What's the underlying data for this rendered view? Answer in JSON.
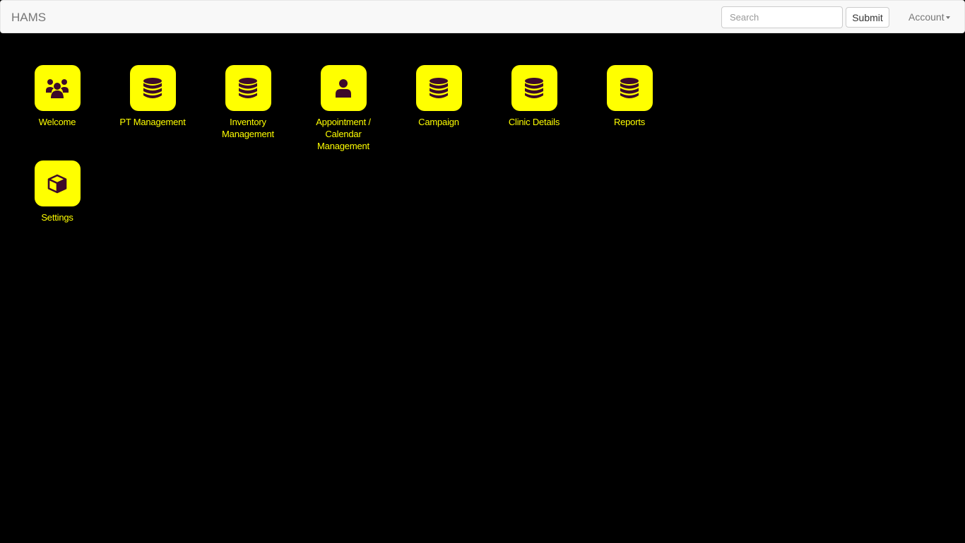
{
  "navbar": {
    "brand": "HAMS",
    "search_placeholder": "Search",
    "search_value": "",
    "submit_label": "Submit",
    "account_label": "Account"
  },
  "tiles": [
    {
      "label": "Welcome",
      "icon": "users-icon"
    },
    {
      "label": "PT Management",
      "icon": "database-icon"
    },
    {
      "label": "Inventory Management",
      "icon": "database-icon"
    },
    {
      "label": "Appointment / Calendar Management",
      "icon": "user-icon"
    },
    {
      "label": "Campaign",
      "icon": "database-icon"
    },
    {
      "label": "Clinic Details",
      "icon": "database-icon"
    },
    {
      "label": "Reports",
      "icon": "database-icon"
    },
    {
      "label": "Settings",
      "icon": "cube-icon"
    }
  ],
  "colors": {
    "background": "#000000",
    "tile": "#ffff00",
    "icon": "#3d0a2a",
    "label": "#ffff00"
  }
}
